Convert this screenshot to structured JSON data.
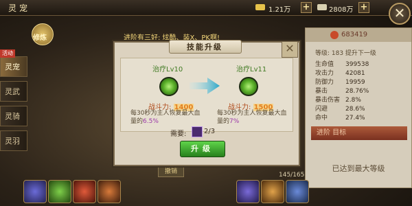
{
  "header": {
    "title": "灵宠",
    "currency1": "1.21万",
    "currency2": "2808万",
    "close_glyph": "✕",
    "plus_glyph": "+"
  },
  "sidebar": {
    "badge": "活动",
    "items": [
      {
        "label": "灵宠",
        "active": true
      },
      {
        "label": "灵武",
        "active": false
      },
      {
        "label": "灵骑",
        "active": false
      },
      {
        "label": "灵羽",
        "active": false
      }
    ]
  },
  "orb_label": "修炼",
  "hint": "进阶有三好: 炫酷、装X、PK啊!",
  "stats_panel": {
    "name": "683419",
    "level_line": "等级: 183  提升下一级",
    "rows": [
      {
        "name": "生命值",
        "value": "399538"
      },
      {
        "name": "攻击力",
        "value": "42081"
      },
      {
        "name": "防御力",
        "value": "19959"
      },
      {
        "name": "暴击",
        "value": "28.76%"
      },
      {
        "name": "暴击伤害",
        "value": "2.8%"
      },
      {
        "name": "闪避",
        "value": "28.6%"
      },
      {
        "name": "命中",
        "value": "27.4%"
      }
    ],
    "advance_label": "进阶 目标",
    "max_level_text": "已达到最大等级"
  },
  "bottom": {
    "bar_label": "撤销",
    "progress": "145/165"
  },
  "dialog": {
    "title": "技能升级",
    "close_glyph": "✕",
    "current": {
      "name": "治疗",
      "level": "Lv10",
      "power_label": "战斗力:",
      "power_value": "1400",
      "desc_main": "每30秒为主人恢复最大血量的",
      "desc_pct": "6.5%"
    },
    "next": {
      "name": "治疗",
      "level": "Lv11",
      "power_label": "战斗力:",
      "power_value": "1500",
      "desc_main": "每30秒为主人恢复最大血量的",
      "desc_pct": "7%"
    },
    "need_label": "需要:",
    "need_count": "2/3",
    "upgrade_button": "升级"
  }
}
